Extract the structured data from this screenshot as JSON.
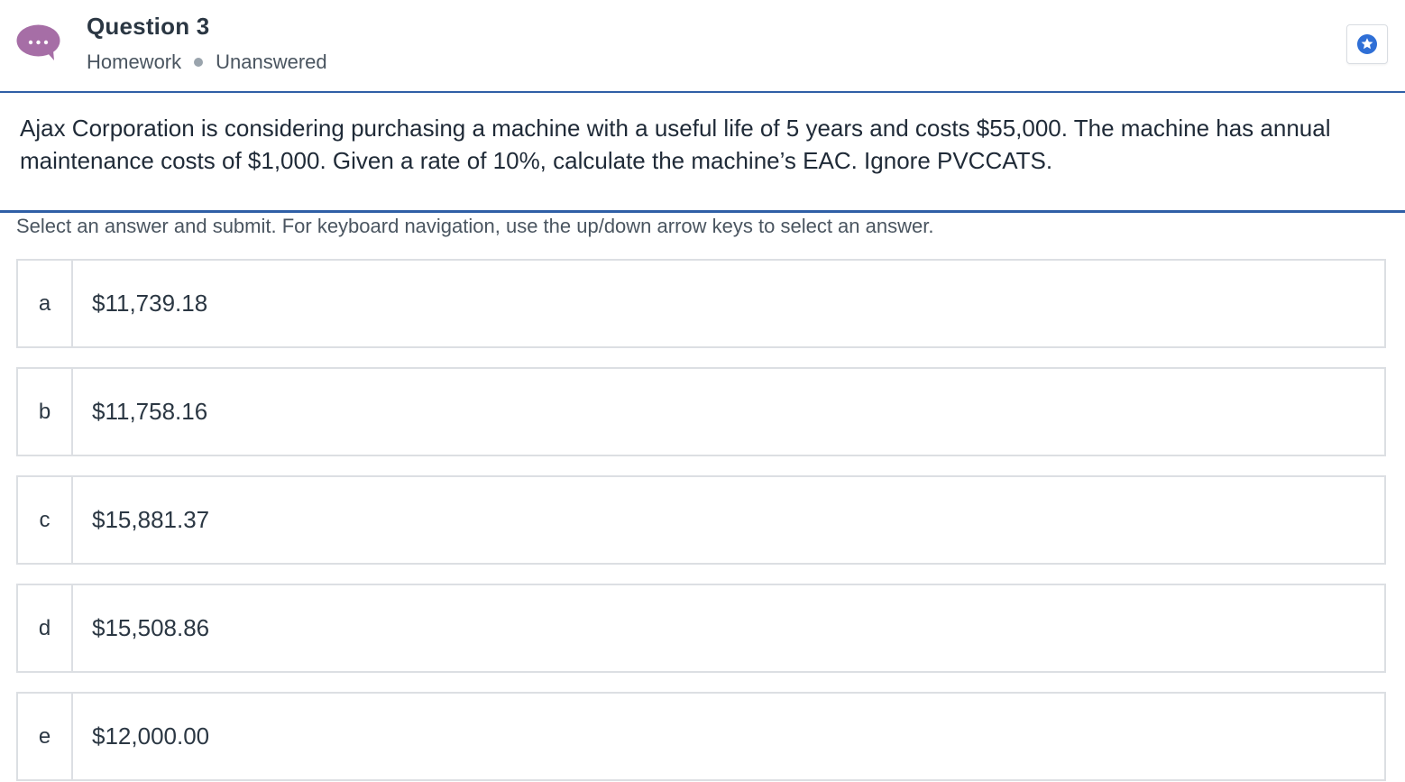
{
  "header": {
    "title": "Question 3",
    "category": "Homework",
    "status": "Unanswered",
    "chat_icon": "chat-bubble-icon",
    "chat_icon_color": "#a66ea6",
    "bookmark_icon": "star-icon",
    "bookmark_icon_color": "#2f6fd6"
  },
  "question": {
    "text": "Ajax Corporation is considering purchasing a machine with a useful life of 5 years and costs $55,000. The machine has annual maintenance costs of $1,000. Given a rate of 10%, calculate the machine’s EAC. Ignore PVCCATS."
  },
  "instructions": "Select an answer and submit. For keyboard navigation, use the up/down arrow keys to select an answer.",
  "options": [
    {
      "letter": "a",
      "value": "$11,739.18"
    },
    {
      "letter": "b",
      "value": "$11,758.16"
    },
    {
      "letter": "c",
      "value": "$15,881.37"
    },
    {
      "letter": "d",
      "value": "$15,508.86"
    },
    {
      "letter": "e",
      "value": "$12,000.00"
    }
  ],
  "colors": {
    "accent": "#2f5fa6",
    "border": "#dcdfe3"
  }
}
